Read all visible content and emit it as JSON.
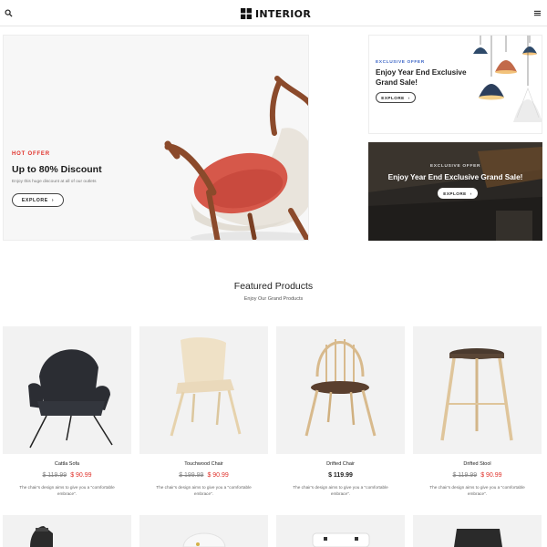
{
  "header": {
    "brand": "INTERIOR",
    "search_icon": "search-icon",
    "menu_icon": "hamburger-menu-icon"
  },
  "hero": {
    "tag": "HOT OFFER",
    "title": "Up to 80% Discount",
    "description": "Enjoy this huge discount at all of our outlets",
    "button": "EXPLORE",
    "slide_count": 3,
    "active_slide": 1
  },
  "promo_top": {
    "tag": "EXCLUSIVE OFFER",
    "title": "Enjoy Year End Exclusive Grand Sale!",
    "button": "EXPLORE"
  },
  "promo_bottom": {
    "tag": "EXCLUSIVE OFFER",
    "title": "Enjoy Year End Exclusive Grand Sale!",
    "button": "EXPLORE"
  },
  "featured": {
    "title": "Featured Products",
    "subtitle": "Enjoy Our Grand Products",
    "products": [
      {
        "name": "Cattla Sofa",
        "old_price": "$ 119.99",
        "price": "$ 90.99",
        "description": "The chair's design aims to give you a \"comfortable embrace\"."
      },
      {
        "name": "Touchwood Chair",
        "old_price": "$ 199.99",
        "price": "$ 90.99",
        "description": "The chair's design aims to give you a \"comfortable embrace\"."
      },
      {
        "name": "Drifted Chair",
        "old_price": "",
        "price": "$ 119.99",
        "description": "The chair's design aims to give you a \"comfortable embrace\"."
      },
      {
        "name": "Drifted Stool",
        "old_price": "$ 119.99",
        "price": "$ 90.99",
        "description": "The chair's design aims to give you a \"comfortable embrace\"."
      }
    ]
  },
  "colors": {
    "accent_red": "#e0322b",
    "accent_blue": "#3d66c6",
    "text_dark": "#222222",
    "card_bg": "#f2f2f2"
  }
}
